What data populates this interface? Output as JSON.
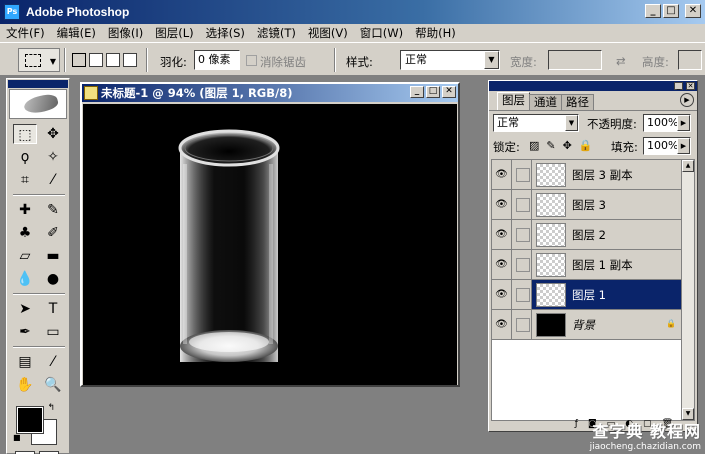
{
  "window": {
    "title": "Adobe Photoshop",
    "min": "_",
    "max": "□",
    "close": "✕"
  },
  "menu": [
    "文件(F)",
    "编辑(E)",
    "图像(I)",
    "图层(L)",
    "选择(S)",
    "滤镜(T)",
    "视图(V)",
    "窗口(W)",
    "帮助(H)"
  ],
  "options": {
    "feather_label": "羽化:",
    "feather_value": "0 像素",
    "antialias_label": "消除锯齿",
    "style_label": "样式:",
    "style_value": "正常",
    "width_label": "宽度:",
    "height_label": "高度:",
    "swap_icon": "⇄"
  },
  "document": {
    "title": "未标题-1 @ 94% (图层 1, RGB/8)"
  },
  "layers_panel": {
    "tabs": [
      "图层",
      "通道",
      "路径"
    ],
    "blend_mode": "正常",
    "opacity_label": "不透明度:",
    "opacity_value": "100%",
    "lock_label": "锁定:",
    "fill_label": "填充:",
    "fill_value": "100%",
    "layers": [
      {
        "name": "图层 3 副本",
        "selected": false,
        "background": false
      },
      {
        "name": "图层 3",
        "selected": false,
        "background": false
      },
      {
        "name": "图层 2",
        "selected": false,
        "background": false
      },
      {
        "name": "图层 1 副本",
        "selected": false,
        "background": false
      },
      {
        "name": "图层 1",
        "selected": true,
        "background": false
      },
      {
        "name": "背景",
        "selected": false,
        "background": true
      }
    ]
  },
  "colors": {
    "foreground": "#000000",
    "background": "#ffffff",
    "canvas": "#000000",
    "selected_layer": "#0a246a"
  },
  "watermark": {
    "line1": "查字典 教程网",
    "line2": "jiaocheng.chazidian.com"
  }
}
